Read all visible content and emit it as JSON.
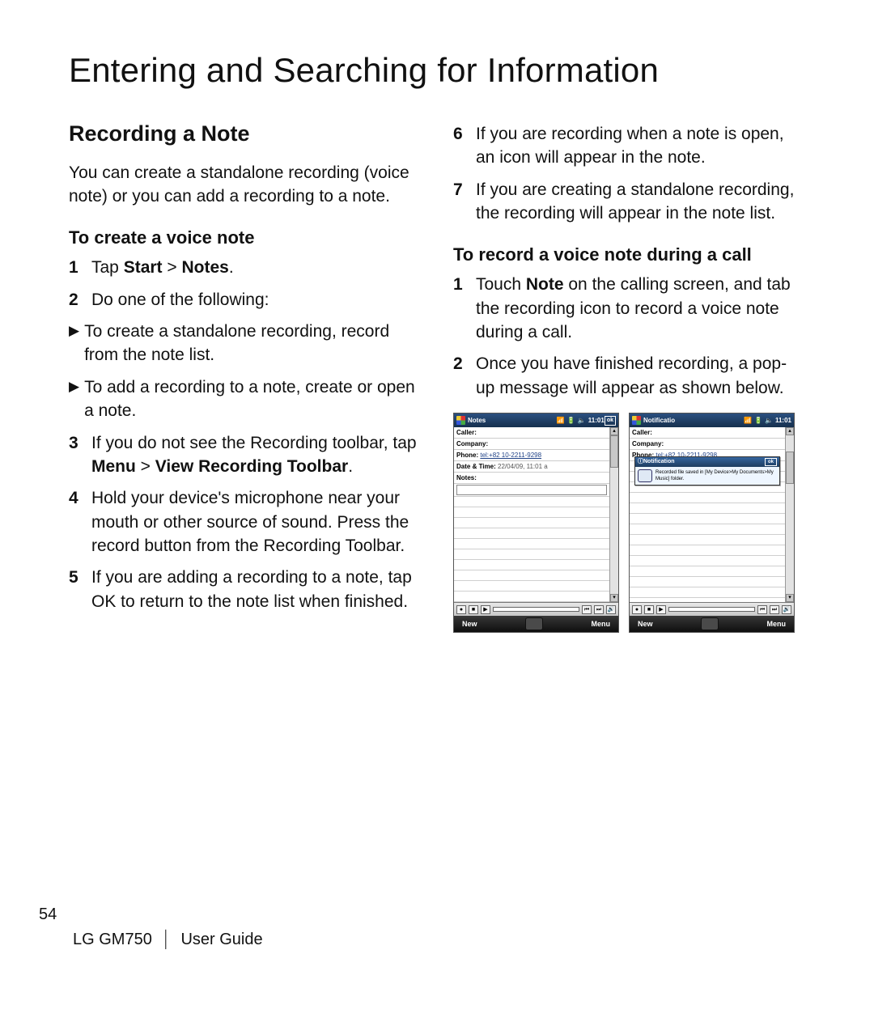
{
  "chapter_title": "Entering and Searching for Information",
  "section_title": "Recording a Note",
  "intro": "You can create a standalone recording (voice note) or you can add a recording to a note.",
  "subhead_a": "To create a voice note",
  "step1_pre": "Tap ",
  "step1_b1": "Start",
  "step1_mid": " > ",
  "step1_b2": "Notes",
  "step1_post": ".",
  "step2": "Do one of the following:",
  "bullet1": "To create a standalone recording, record from the note list.",
  "bullet2": "To add a recording to a note, create or open a note.",
  "step3_pre": "If you do not see the Recording toolbar, tap ",
  "step3_b1": "Menu",
  "step3_mid": " > ",
  "step3_b2": "View Recording Toolbar",
  "step3_post": ".",
  "step4": "Hold your device's microphone near your mouth or other source of sound. Press the record button from the Recording Toolbar.",
  "step5": "If you are adding a recording to a note, tap OK to return to the note list when finished.",
  "step6": "If you are recording when a note is open, an icon will appear in the note.",
  "step7": "If you are creating a standalone recording, the recording will appear in the note list.",
  "subhead_b": "To record a voice note during a call",
  "b_step1_pre": "Touch ",
  "b_step1_b1": "Note",
  "b_step1_post": " on the calling screen, and tab the recording icon to record a voice note during a call.",
  "b_step2": "Once you have finished recording, a pop-up message will appear as shown below.",
  "footer": {
    "page_number": "54",
    "model": "LG GM750",
    "guide": "User Guide"
  },
  "phone_a": {
    "title": "Notes",
    "time": "11:01",
    "ok": "ok",
    "caller_label": "Caller:",
    "company_label": "Company:",
    "phone_label": "Phone:",
    "phone_value": "tel:+82 10-2211-9298",
    "datetime_label": "Date & Time:",
    "datetime_value": "22/04/09, 11:01 a",
    "notes_label": "Notes:",
    "soft_left": "New",
    "soft_right": "Menu"
  },
  "phone_b": {
    "title": "Notificatio",
    "time": "11:01",
    "caller_label": "Caller:",
    "company_label": "Company:",
    "phone_label": "Phone:",
    "phone_value": "tel:+82 10-2211-9298",
    "popup_title": "Notification",
    "popup_ok": "ok",
    "popup_text": "Recorded file saved in [My Device>My Documents>My Music] folder.",
    "soft_left": "New",
    "soft_right": "Menu"
  }
}
